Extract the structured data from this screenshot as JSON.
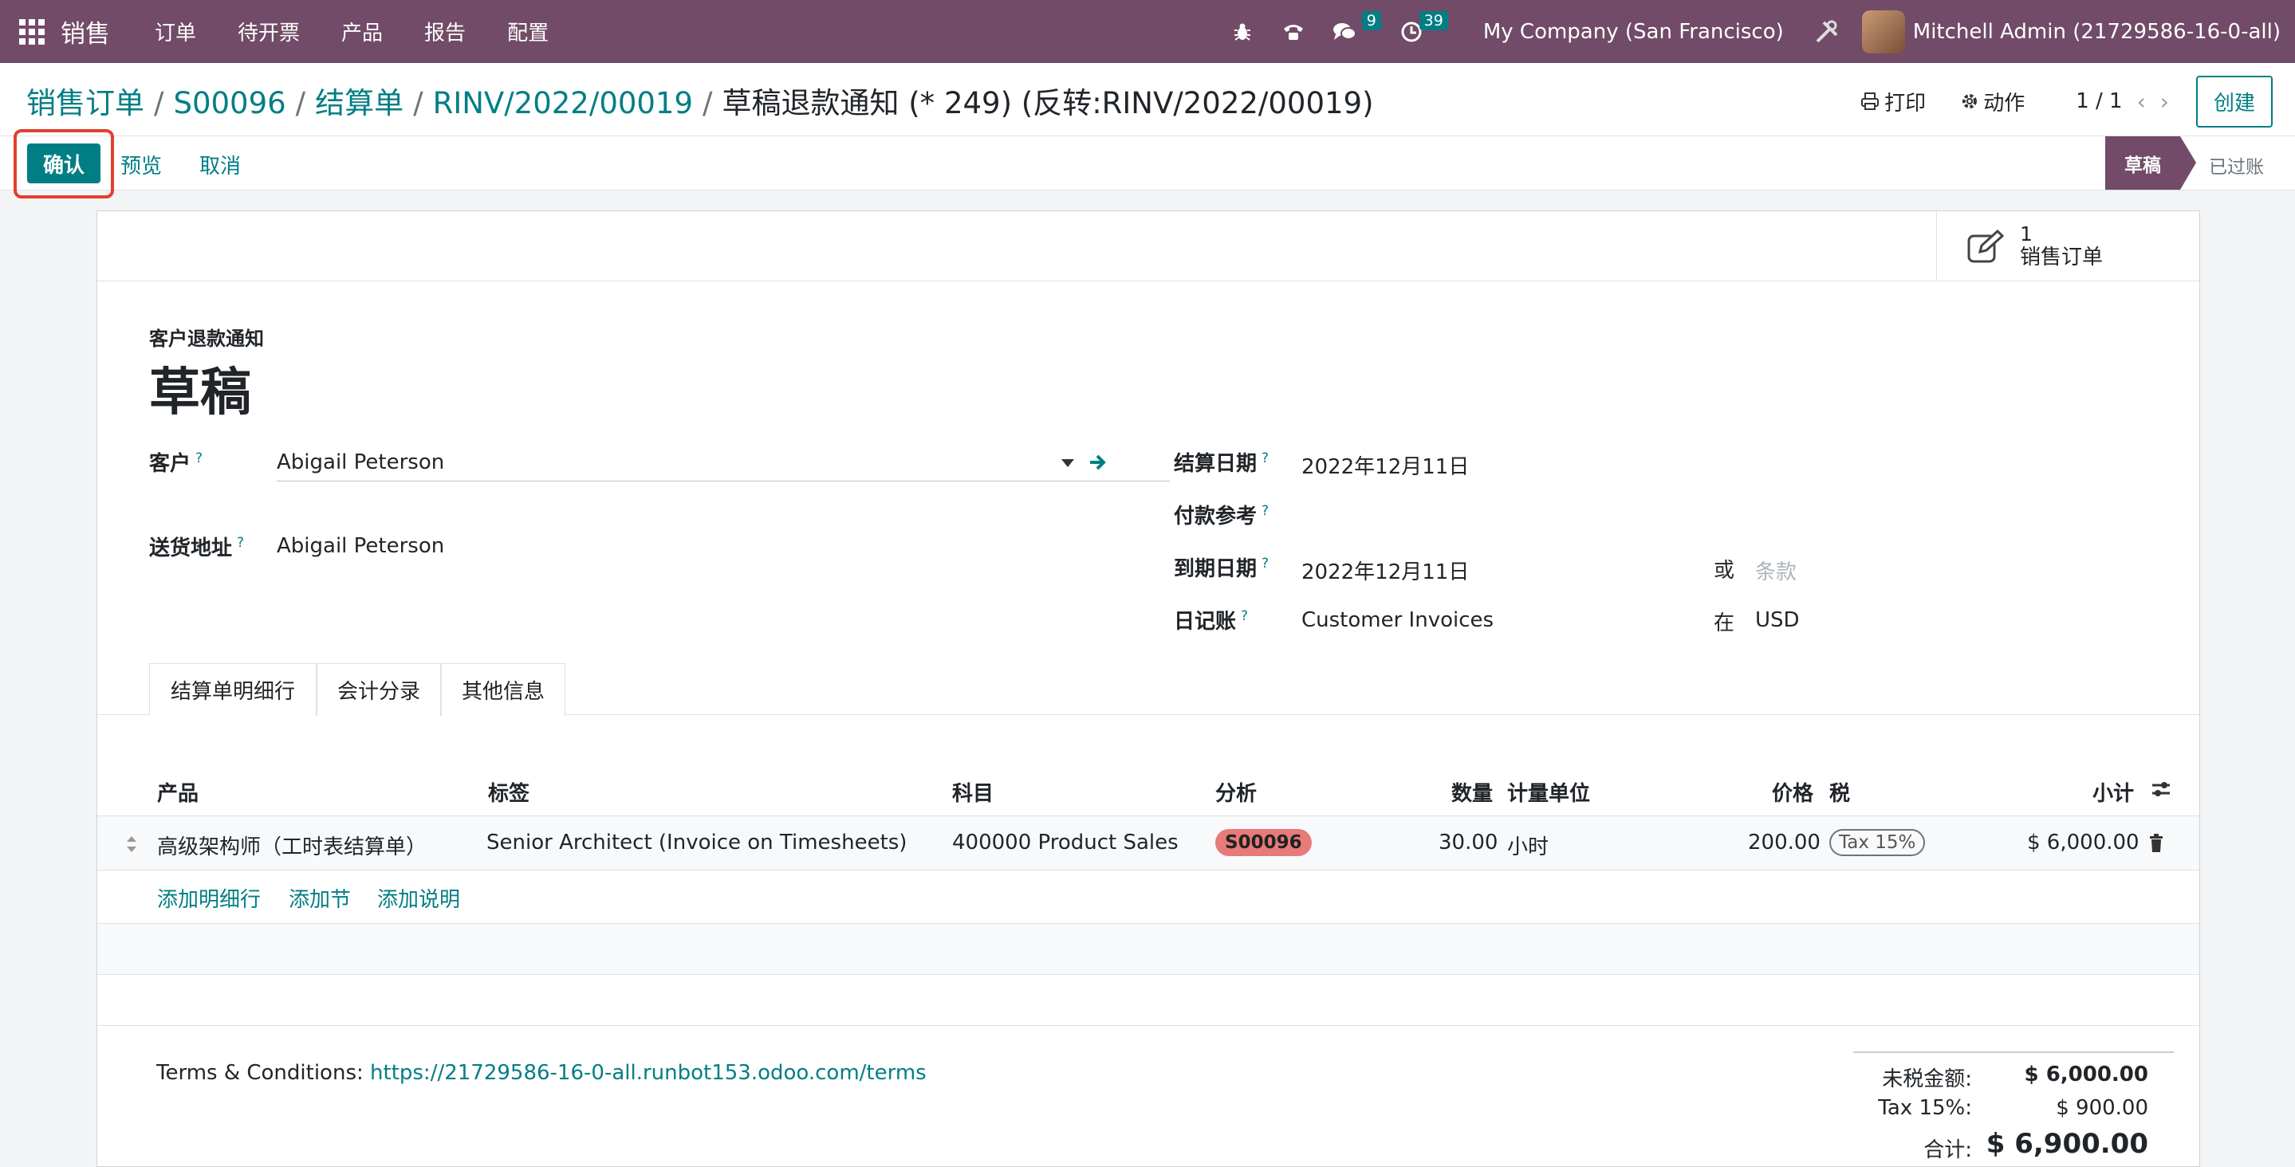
{
  "navbar": {
    "app_name": "销售",
    "menu": [
      "订单",
      "待开票",
      "产品",
      "报告",
      "配置"
    ],
    "messages_count": "9",
    "activities_count": "39",
    "company": "My Company (San Francisco)",
    "user": "Mitchell Admin (21729586-16-0-all)"
  },
  "breadcrumb": {
    "items": [
      "销售订单",
      "S00096",
      "结算单",
      "RINV/2022/00019"
    ],
    "current": "草稿退款通知 (* 249) (反转:RINV/2022/00019)"
  },
  "control": {
    "print": "打印",
    "action": "动作",
    "pager": "1 / 1",
    "create": "创建"
  },
  "statusbar": {
    "confirm": "确认",
    "preview": "预览",
    "cancel": "取消",
    "stage_active": "草稿",
    "stage_next": "已过账"
  },
  "smart_button": {
    "count": "1",
    "label": "销售订单"
  },
  "form": {
    "doc_type": "客户退款通知",
    "title": "草稿",
    "customer_label": "客户",
    "customer_value": "Abigail Peterson",
    "delivery_label": "送货地址",
    "delivery_value": "Abigail Peterson",
    "invoice_date_label": "结算日期",
    "invoice_date_value": "2022年12月11日",
    "payment_ref_label": "付款参考",
    "due_date_label": "到期日期",
    "due_date_value": "2022年12月11日",
    "or_label": "或",
    "terms_placeholder": "条款",
    "journal_label": "日记账",
    "journal_value": "Customer Invoices",
    "in_label": "在",
    "currency_value": "USD",
    "help_mark": "?"
  },
  "tabs": [
    "结算单明细行",
    "会计分录",
    "其他信息"
  ],
  "table": {
    "headers": {
      "product": "产品",
      "label": "标签",
      "account": "科目",
      "analytic": "分析",
      "quantity": "数量",
      "uom": "计量单位",
      "price": "价格",
      "tax": "税",
      "subtotal": "小计"
    },
    "rows": [
      {
        "product": "高级架构师（工时表结算单）",
        "label": "Senior Architect (Invoice on Timesheets)",
        "account": "400000 Product Sales",
        "analytic": "S00096",
        "quantity": "30.00",
        "uom": "小时",
        "price": "200.00",
        "tax": "Tax 15%",
        "subtotal": "$ 6,000.00"
      }
    ],
    "add_line": "添加明细行",
    "add_section": "添加节",
    "add_note": "添加说明"
  },
  "footer": {
    "terms_label": "Terms & Conditions:",
    "terms_link": "https://21729586-16-0-all.runbot153.odoo.com/terms",
    "untaxed_label": "未税金额:",
    "untaxed_value": "$ 6,000.00",
    "tax_label": "Tax 15%:",
    "tax_value": "$ 900.00",
    "total_label": "合计:",
    "total_value": "$ 6,900.00"
  },
  "colors": {
    "brand": "#714b67",
    "accent": "#017e84",
    "highlight_border": "#e23f2f",
    "analytic_tag": "#e87a7a"
  }
}
